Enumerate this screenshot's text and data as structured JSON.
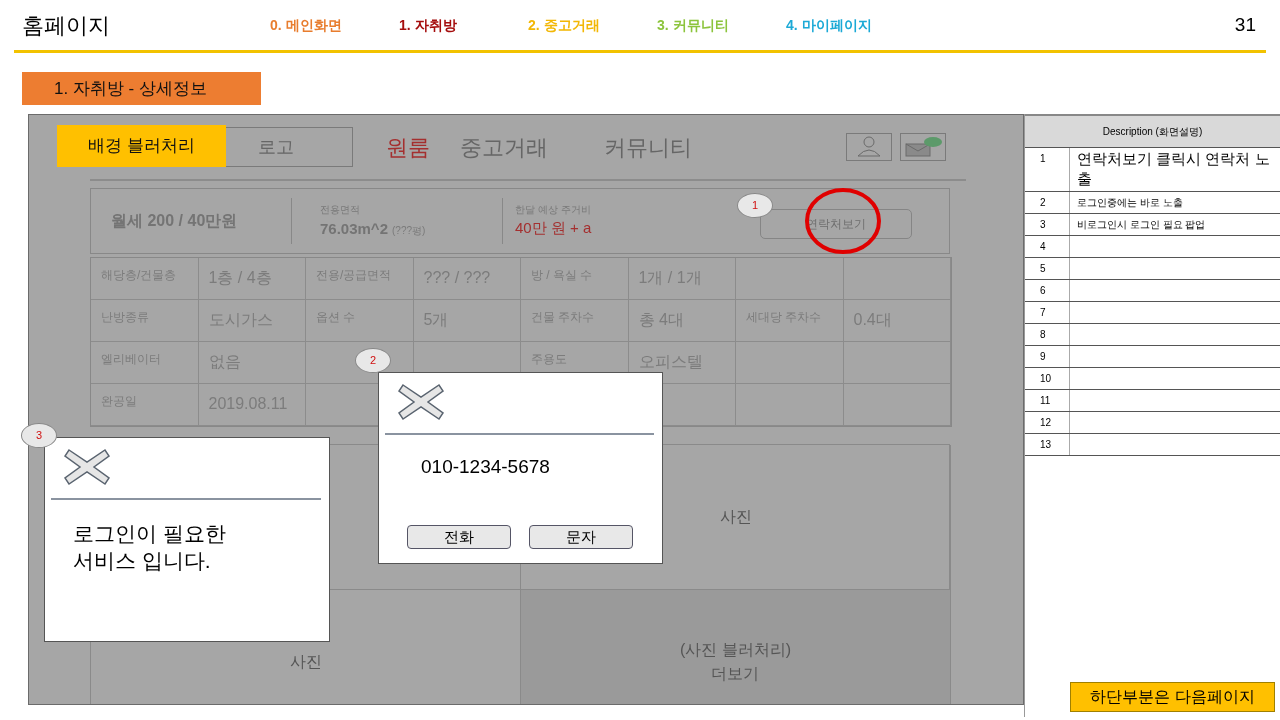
{
  "header": {
    "title": "홈페이지",
    "page_number": "31",
    "nav": [
      {
        "label": "0. 메인화면",
        "color": "#e87d2e"
      },
      {
        "label": "1. 자취방",
        "color": "#a50d0d"
      },
      {
        "label": "2. 중고거래",
        "color": "#f2b705"
      },
      {
        "label": "3. 커뮤니티",
        "color": "#8cc43c"
      },
      {
        "label": "4. 마이페이지",
        "color": "#1ba9d6"
      }
    ]
  },
  "section_label": "1. 자취방 - 상세정보",
  "mockup": {
    "note": "배경 블러처리",
    "logo": "로고",
    "menu": [
      {
        "label": "원룸",
        "selected": true
      },
      {
        "label": "중고거래",
        "selected": false
      },
      {
        "label": "커뮤니티",
        "selected": false
      }
    ],
    "summary": {
      "price": "월세 200 / 40만원",
      "area_label": "전용면적",
      "area": "76.03m^2",
      "area_note": "(???평)",
      "cost_label": "한달 예상 주거비",
      "cost": "40만 원 + a",
      "contact_button": "연락처보기",
      "marker": "1"
    },
    "details": [
      [
        {
          "kind": "pair",
          "label": "해당층/건물층",
          "value": "1층 / 4층"
        },
        {
          "kind": "pair",
          "label": "전용/공급면적",
          "value": "??? / ???"
        },
        {
          "kind": "pair",
          "label": "방 / 욕실 수",
          "value": "1개 / 1개"
        },
        {
          "kind": "blank"
        }
      ],
      [
        {
          "kind": "pair",
          "label": "난방종류",
          "value": "도시가스"
        },
        {
          "kind": "pair",
          "label": "옵션 수",
          "value": "5개"
        },
        {
          "kind": "pair",
          "label": "건물 주차수",
          "value": "총 4대"
        },
        {
          "kind": "pair",
          "label": "세대당 주차수",
          "value": "0.4대"
        }
      ],
      [
        {
          "kind": "pair",
          "label": "엘리베이터",
          "value": "없음"
        },
        {
          "kind": "blank"
        },
        {
          "kind": "pair",
          "label": "주용도",
          "value": "오피스텔"
        },
        {
          "kind": "blank"
        }
      ],
      [
        {
          "kind": "pair",
          "label": "완공일",
          "value": "2019.08.11"
        },
        {
          "kind": "blank"
        },
        {
          "kind": "blank"
        },
        {
          "kind": "blank"
        }
      ]
    ],
    "photos": [
      {
        "blurred": false
      },
      {
        "caption": "사진",
        "blurred": false
      },
      {
        "caption": "사진",
        "blurred": false
      },
      {
        "caption": "(사진 블러처리)\n더보기",
        "blurred": true
      }
    ]
  },
  "popups": {
    "contact": {
      "marker": "2",
      "phone": "010-1234-5678",
      "buttons": [
        "전화",
        "문자"
      ]
    },
    "login": {
      "marker": "3",
      "message": "로그인이 필요한\n서비스 입니다."
    }
  },
  "description": {
    "title": "Description (화면설명)",
    "rows": [
      {
        "number": "1",
        "text": "연락처보기 클릭시 연락처 노출"
      },
      {
        "number": "2",
        "text": "로그인중에는 바로 노출"
      },
      {
        "number": "3",
        "text": "비로그인시 로그인 필요 팝업"
      },
      {
        "number": "4"
      },
      {
        "number": "5"
      },
      {
        "number": "6"
      },
      {
        "number": "7"
      },
      {
        "number": "8"
      },
      {
        "number": "9"
      },
      {
        "number": "10"
      },
      {
        "number": "11"
      },
      {
        "number": "12"
      },
      {
        "number": "13"
      }
    ]
  },
  "footer_note": "하단부분은 다음페이지"
}
